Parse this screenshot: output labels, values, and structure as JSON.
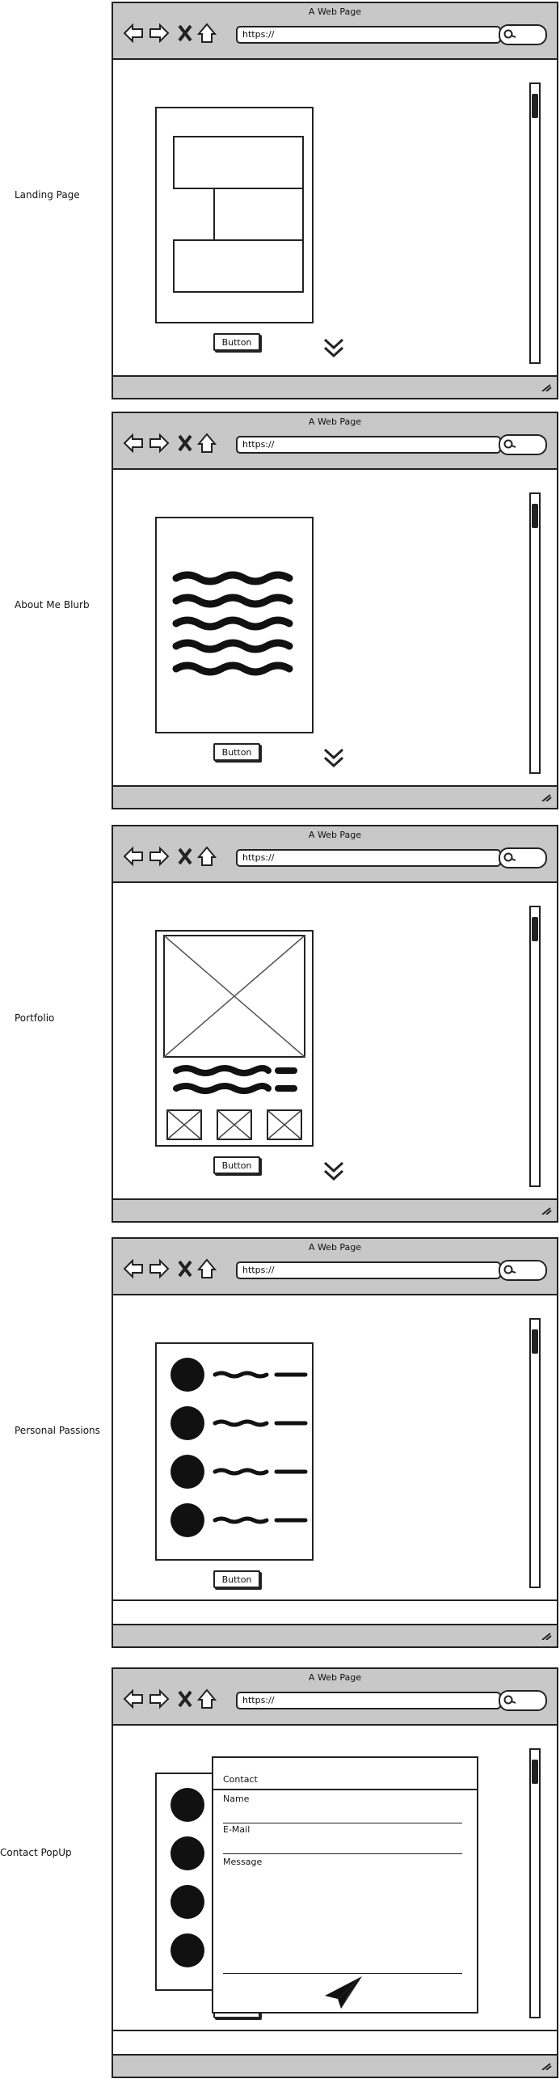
{
  "labels": [
    "Landing Page",
    "About Me Blurb",
    "Portfolio",
    "Personal Passions",
    "Contact PopUp"
  ],
  "browser": {
    "title": "A Web Page",
    "url": "https://"
  },
  "button_label": "Button",
  "contact_popup": {
    "heading": "Contact",
    "fields": [
      "Name",
      "E-Mail",
      "Message"
    ]
  }
}
